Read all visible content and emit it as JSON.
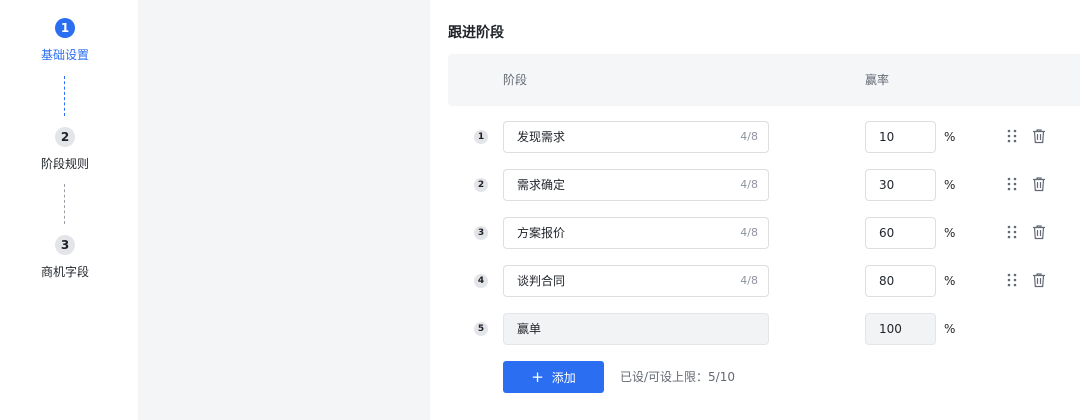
{
  "stepper": {
    "steps": [
      {
        "num": "1",
        "label": "基础设置",
        "state": "active"
      },
      {
        "num": "2",
        "label": "阶段规则",
        "state": "idle"
      },
      {
        "num": "3",
        "label": "商机字段",
        "state": "idle"
      }
    ]
  },
  "section": {
    "title": "跟进阶段",
    "col_stage": "阶段",
    "col_rate": "赢率"
  },
  "stages": [
    {
      "num": "1",
      "name": "发现需求",
      "count": "4/8",
      "rate": "10",
      "pct": "%",
      "editable": true
    },
    {
      "num": "2",
      "name": "需求确定",
      "count": "4/8",
      "rate": "30",
      "pct": "%",
      "editable": true
    },
    {
      "num": "3",
      "name": "方案报价",
      "count": "4/8",
      "rate": "60",
      "pct": "%",
      "editable": true
    },
    {
      "num": "4",
      "name": "谈判合同",
      "count": "4/8",
      "rate": "80",
      "pct": "%",
      "editable": true
    },
    {
      "num": "5",
      "name": "赢单",
      "count": "",
      "rate": "100",
      "pct": "%",
      "editable": false
    }
  ],
  "footer": {
    "add_label": "添加",
    "limit_text": "已设/可设上限：5/10"
  },
  "colors": {
    "primary": "#2b6ef2",
    "panel_gray": "#f4f5f7"
  }
}
